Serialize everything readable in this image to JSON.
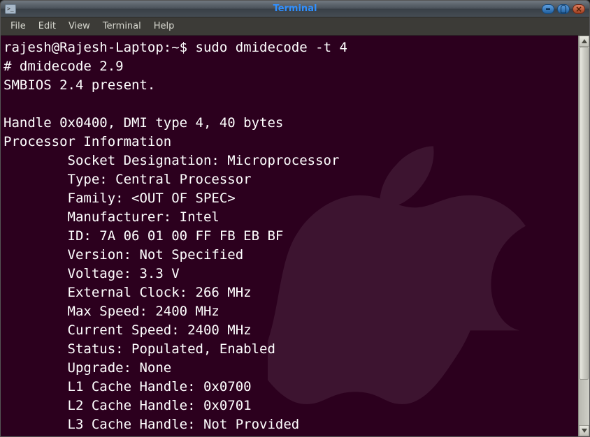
{
  "window": {
    "title": "Terminal"
  },
  "menu": {
    "file": "File",
    "edit": "Edit",
    "view": "View",
    "terminal": "Terminal",
    "help": "Help"
  },
  "prompt": {
    "userhost": "rajesh@Rajesh-Laptop:~$ ",
    "command": "sudo dmidecode -t 4"
  },
  "out": {
    "l1": "# dmidecode 2.9",
    "l2": "SMBIOS 2.4 present.",
    "l3": "",
    "l4": "Handle 0x0400, DMI type 4, 40 bytes",
    "l5": "Processor Information",
    "l6": "        Socket Designation: Microprocessor",
    "l7": "        Type: Central Processor",
    "l8": "        Family: <OUT OF SPEC>",
    "l9": "        Manufacturer: Intel",
    "l10": "        ID: 7A 06 01 00 FF FB EB BF",
    "l11": "        Version: Not Specified",
    "l12": "        Voltage: 3.3 V",
    "l13": "        External Clock: 266 MHz",
    "l14": "        Max Speed: 2400 MHz",
    "l15": "        Current Speed: 2400 MHz",
    "l16": "        Status: Populated, Enabled",
    "l17": "        Upgrade: None",
    "l18": "        L1 Cache Handle: 0x0700",
    "l19": "        L2 Cache Handle: 0x0701",
    "l20": "        L3 Cache Handle: Not Provided"
  }
}
